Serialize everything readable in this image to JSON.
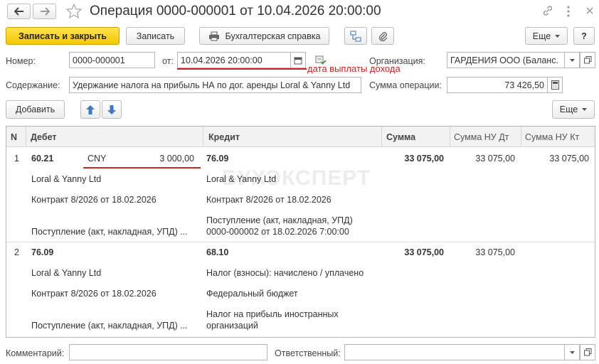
{
  "window": {
    "title": "Операция 0000-000001 от 10.04.2026 20:00:00"
  },
  "toolbar": {
    "save_close": "Записать и закрыть",
    "save": "Записать",
    "report": "Бухгалтерская справка",
    "more": "Еще",
    "help": "?"
  },
  "form": {
    "number_label": "Номер:",
    "number_value": "0000-000001",
    "date_label": "от:",
    "date_value": "10.04.2026 20:00:00",
    "annotation": "дата выплаты дохода",
    "org_label": "Организация:",
    "org_value": "ГАРДЕНИЯ ООО (Баланс.",
    "content_label": "Содержание:",
    "content_value": "Удержание налога на прибыль НА по дог. аренды Loral & Yanny Ltd",
    "sum_label": "Сумма операции:",
    "sum_value": "73 426,50"
  },
  "table_toolbar": {
    "add": "Добавить",
    "more": "Еще"
  },
  "table": {
    "headers": {
      "n": "N",
      "debit": "Дебет",
      "credit": "Кредит",
      "sum": "Сумма",
      "sum_nu_dt": "Сумма НУ Дт",
      "sum_nu_kt": "Сумма НУ Кт"
    },
    "rows": [
      {
        "n": "1",
        "debit_account": "60.21",
        "currency": "CNY",
        "currency_amount": "3 000,00",
        "debit_sub1": "Loral & Yanny Ltd",
        "debit_sub2": "Контракт 8/2026 от 18.02.2026",
        "debit_sub3": "Поступление (акт, накладная, УПД) ...",
        "credit_account": "76.09",
        "credit_sub1": "Loral & Yanny Ltd",
        "credit_sub2": "Контракт 8/2026 от 18.02.2026",
        "credit_sub3a": "Поступление (акт, накладная, УПД)",
        "credit_sub3b": "0000-000002 от 18.02.2026 7:00:00",
        "sum": "33 075,00",
        "sum_nu_dt": "33 075,00",
        "sum_nu_kt": "33 075,00"
      },
      {
        "n": "2",
        "debit_account": "76.09",
        "debit_sub1": "Loral & Yanny Ltd",
        "debit_sub2": "Контракт 8/2026 от 18.02.2026",
        "debit_sub3": "Поступление (акт, накладная, УПД) ...",
        "credit_account": "68.10",
        "credit_sub1": "Налог (взносы): начислено / уплачено",
        "credit_sub2": "Федеральный бюджет",
        "credit_sub3a": "Налог на прибыль иностранных",
        "credit_sub3b": "организаций",
        "sum": "33 075,00",
        "sum_nu_dt": "33 075,00"
      }
    ]
  },
  "footer": {
    "comment_label": "Комментарий:",
    "comment_value": "",
    "responsible_label": "Ответственный:",
    "responsible_value": ""
  },
  "watermark": "БУХЭКСПЕРТ",
  "colors": {
    "primary_button": "#f5c800",
    "annotation_red": "#d42020",
    "header_bg": "#f2f2f2"
  }
}
